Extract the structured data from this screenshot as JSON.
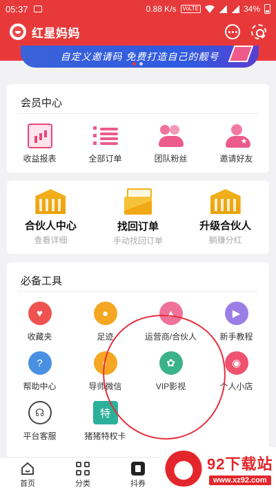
{
  "status_bar": {
    "time": "05:37",
    "net_speed": "0.88 K/s",
    "net_badge": "VoLTE",
    "battery": "34%"
  },
  "header": {
    "title": "红星妈妈"
  },
  "banner": {
    "text": "自定义邀请码 免费打造自己的靓号"
  },
  "member": {
    "title": "会员中心",
    "items": [
      {
        "label": "收益报表",
        "icon": "report-chart-icon"
      },
      {
        "label": "全部订单",
        "icon": "list-icon"
      },
      {
        "label": "团队粉丝",
        "icon": "team-icon"
      },
      {
        "label": "邀请好友",
        "icon": "invite-user-icon"
      }
    ]
  },
  "partner": {
    "items": [
      {
        "title": "合伙人中心",
        "sub": "查看详细",
        "icon": "bank-icon"
      },
      {
        "title": "找回订单",
        "sub": "手动找回订单",
        "icon": "envelope-icon"
      },
      {
        "title": "升级合伙人",
        "sub": "躺赚分红",
        "icon": "bank-icon"
      }
    ]
  },
  "tools": {
    "title": "必备工具",
    "items": [
      {
        "label": "收藏夹",
        "icon": "heart-icon",
        "color": "#ef5350"
      },
      {
        "label": "足迹",
        "icon": "footprint-icon",
        "color": "#f5a623"
      },
      {
        "label": "运营商/合伙人",
        "icon": "bank-icon",
        "color": "#f0729b"
      },
      {
        "label": "新手教程",
        "icon": "play-icon",
        "color": "#9b7de6"
      },
      {
        "label": "帮助中心",
        "icon": "help-icon",
        "color": "#4a90e2"
      },
      {
        "label": "导师微信",
        "icon": "wechat-icon",
        "color": "#f5a623"
      },
      {
        "label": "VIP影视",
        "icon": "film-reel-icon",
        "color": "#3bb38a"
      },
      {
        "label": "个人小店",
        "icon": "shop-icon",
        "color": "#ef5370"
      },
      {
        "label": "平台客服",
        "icon": "headset-icon",
        "color": "#ffffff"
      },
      {
        "label": "猪猪特权卡",
        "icon": "card-icon",
        "color": "#2bb09b"
      }
    ]
  },
  "tabbar": {
    "items": [
      {
        "label": "首页",
        "icon": "home-icon"
      },
      {
        "label": "分类",
        "icon": "category-icon"
      },
      {
        "label": "抖券",
        "icon": "coupon-icon"
      }
    ]
  },
  "watermark": {
    "name": "92下载站",
    "url": "www.xz92.com"
  }
}
